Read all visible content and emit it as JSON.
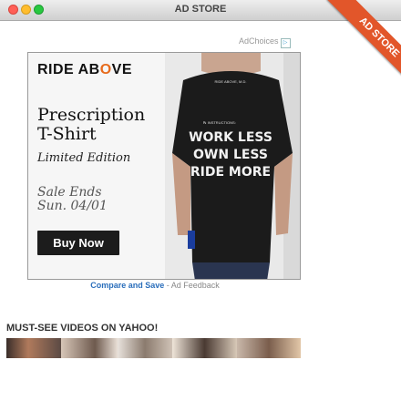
{
  "window": {
    "title": "AD STORE"
  },
  "corner_banner": {
    "label": "AD STORE",
    "color": "#e2562a"
  },
  "adchoices": {
    "label": "AdChoices",
    "icon": "adchoices-triangle-icon"
  },
  "ad": {
    "brand_prefix": "RIDE AB",
    "brand_o": "O",
    "brand_suffix": "VE",
    "product_line1": "Prescription",
    "product_line2": "T-Shirt",
    "edition": "Limited Edition",
    "sale_line1": "Sale Ends",
    "sale_line2": "Sun. 04/01",
    "buy_label": "Buy Now",
    "shirt": {
      "top_text": "RIDE ABOVE, M.D.",
      "rx_label": "℞ INSTRUCTIONS:",
      "line1": "WORK LESS",
      "line2": "OWN LESS",
      "line3": "RIDE MORE"
    }
  },
  "footer": {
    "compare_label": "Compare and Save",
    "separator": " - ",
    "feedback_label": "Ad Feedback"
  },
  "videos": {
    "label": "MUST-SEE VIDEOS ON YAHOO!"
  },
  "colors": {
    "accent_orange": "#e76b1c",
    "link_blue": "#2a6ebb"
  }
}
